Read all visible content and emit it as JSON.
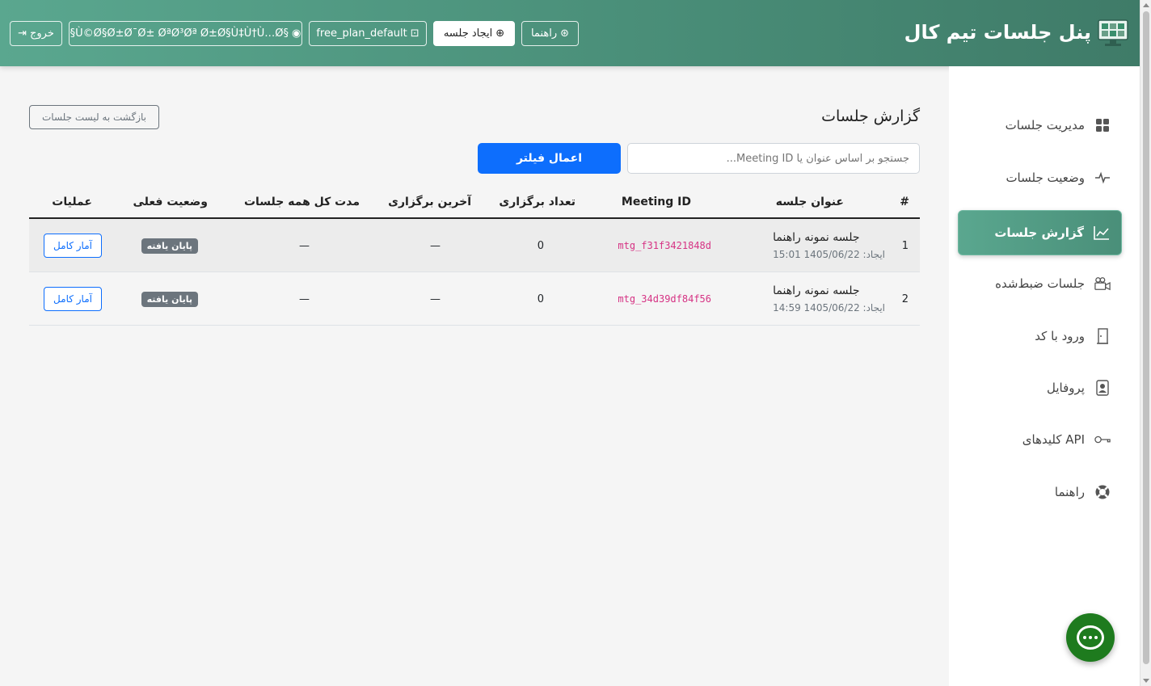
{
  "header": {
    "brand_title": "پنل جلسات تیم کال",
    "buttons": {
      "help": "راهنما",
      "create_meeting": "ایجاد جلسه",
      "plan": "free_plan_default",
      "user": "§Ù©Ø§Ø±Ø¯Ø± ØªØ³Øª Ø±Ø§Ù‡Ù†Ù…Ø§",
      "logout": "خروج"
    }
  },
  "sidebar": {
    "items": [
      {
        "label": "مدیریت جلسات",
        "icon": "grid-icon"
      },
      {
        "label": "وضعیت جلسات",
        "icon": "activity-icon"
      },
      {
        "label": "گزارش جلسات",
        "icon": "chart-line-icon",
        "active": true
      },
      {
        "label": "جلسات ضبط‌شده",
        "icon": "camera-video-icon"
      },
      {
        "label": "ورود با کد",
        "icon": "door-icon"
      },
      {
        "label": "پروفایل",
        "icon": "person-badge-icon"
      },
      {
        "label": "کلیدهای API",
        "icon": "key-icon"
      },
      {
        "label": "راهنما",
        "icon": "life-preserver-icon"
      }
    ]
  },
  "main": {
    "title": "گزارش جلسات",
    "back_button": "بازگشت به لیست جلسات",
    "search_placeholder": "جستجو بر اساس عنوان یا Meeting ID...",
    "filter_button": "اعمال فیلتر",
    "table": {
      "headers": [
        "#",
        "عنوان جلسه",
        "Meeting ID",
        "تعداد برگزاری",
        "آخرین برگزاری",
        "مدت کل همه جلسات",
        "وضعیت فعلی",
        "عملیات"
      ],
      "rows": [
        {
          "num": "1",
          "title": "جلسه نمونه راهنما",
          "created": "ایجاد: 1405/06/22 15:01",
          "meeting_id": "mtg_f31f3421848d",
          "count": "0",
          "last": "—",
          "duration": "—",
          "status": "پایان یافته",
          "action": "آمار کامل"
        },
        {
          "num": "2",
          "title": "جلسه نمونه راهنما",
          "created": "ایجاد: 1405/06/22 14:59",
          "meeting_id": "mtg_34d39df84f56",
          "count": "0",
          "last": "—",
          "duration": "—",
          "status": "پایان یافته",
          "action": "آمار کامل"
        }
      ]
    }
  },
  "colors": {
    "header": "#4a8f79",
    "primary": "#0d6efd",
    "chat": "#1e7b1e"
  }
}
